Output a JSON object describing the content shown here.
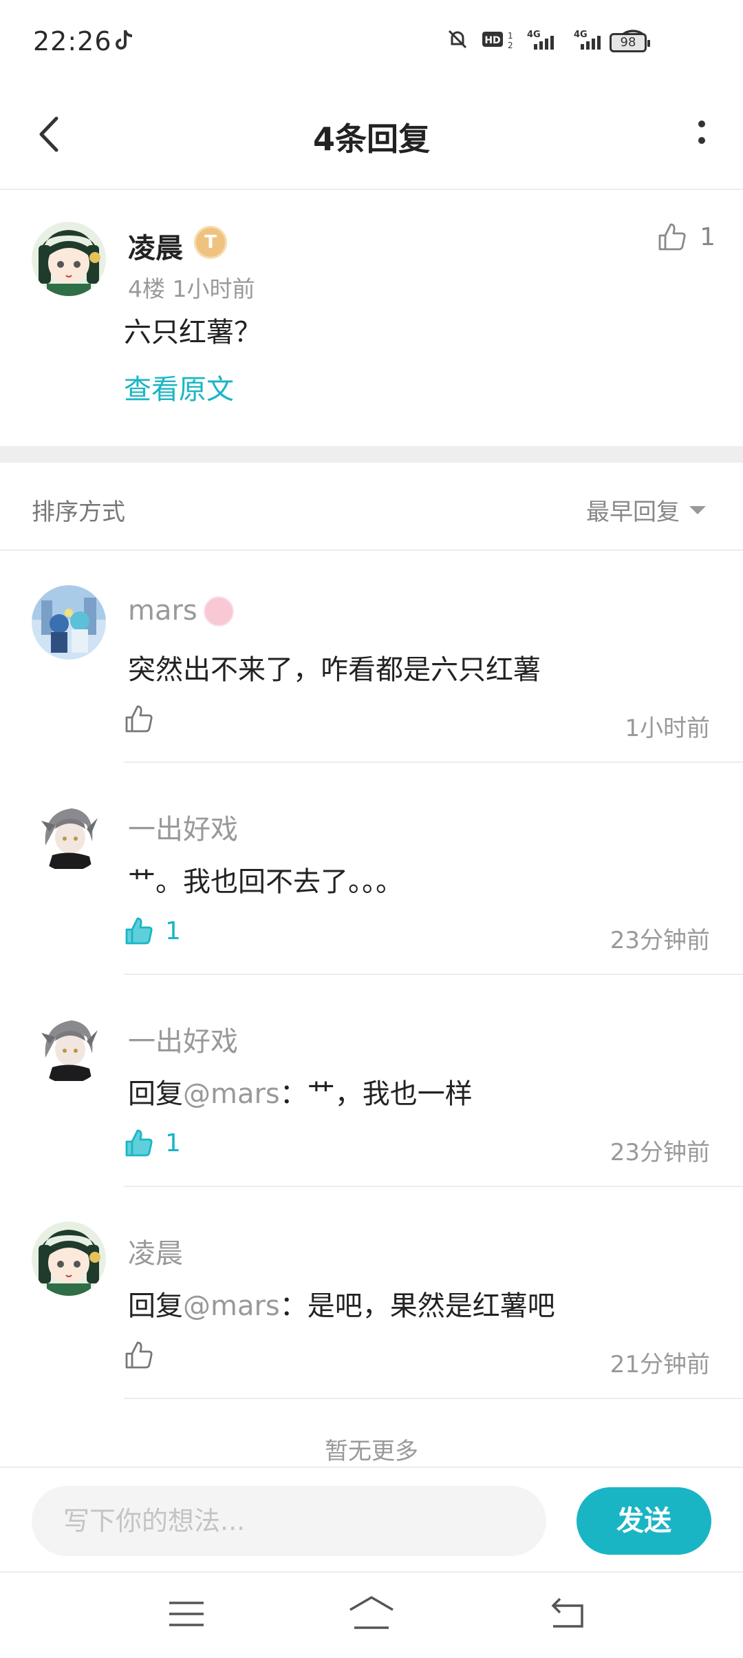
{
  "status_bar": {
    "time": "22:26",
    "battery": "98",
    "icons": [
      "tiktok-icon",
      "mute-icon",
      "hd-icon",
      "signal-4g-icon",
      "signal-4g-icon",
      "wifi-icon",
      "battery-icon"
    ]
  },
  "header": {
    "title": "4条回复",
    "back_icon": "chevron-left-icon",
    "more_icon": "more-vertical-icon"
  },
  "post": {
    "author": "凌晨",
    "level_badge": "T",
    "meta": "4楼   1小时前",
    "content": "六只红薯？",
    "view_original": "查看原文",
    "like_count": "1"
  },
  "sort": {
    "label": "排序方式",
    "value": "最早回复"
  },
  "replies": [
    {
      "author": "mars",
      "text": "突然出不来了，咋看都是六只红薯",
      "mention": "",
      "likes": "",
      "liked": false,
      "time": "1小时前"
    },
    {
      "author": "一出好戏",
      "text": "艹。我也回不去了。。。",
      "mention": "",
      "likes": "1",
      "liked": true,
      "time": "23分钟前"
    },
    {
      "author": "一出好戏",
      "reply_prefix": "回复",
      "mention": "@mars",
      "text": "：艹，我也一样",
      "likes": "1",
      "liked": true,
      "time": "23分钟前"
    },
    {
      "author": "凌晨",
      "reply_prefix": "回复",
      "mention": "@mars",
      "text": "：是吧，果然是红薯吧",
      "likes": "",
      "liked": false,
      "time": "21分钟前"
    }
  ],
  "no_more": "暂无更多",
  "input": {
    "placeholder": "写下你的想法...",
    "send_label": "发送"
  },
  "colors": {
    "accent": "#1ab5c4",
    "muted_text": "#999999"
  }
}
